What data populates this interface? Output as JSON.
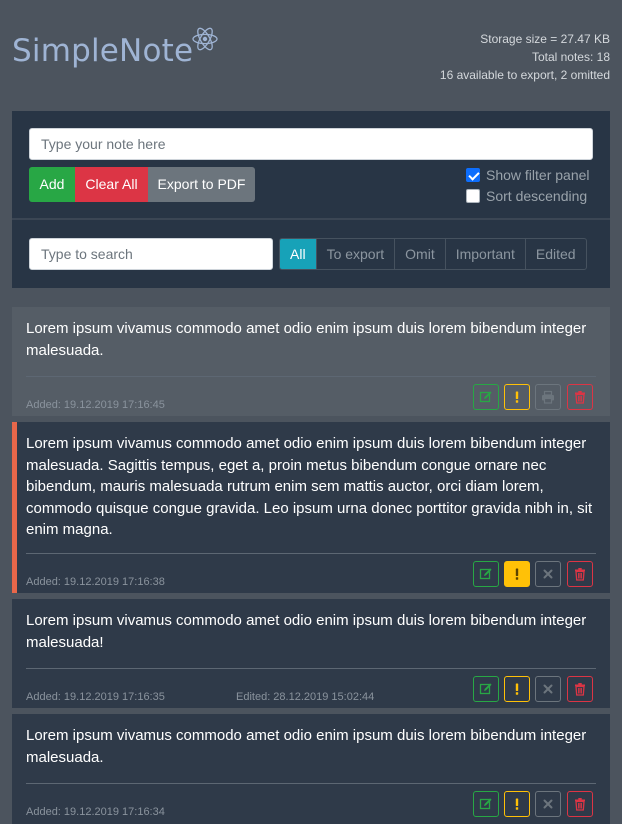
{
  "app": {
    "title": "SimpleNote",
    "logo_icon": "react-atom-icon"
  },
  "stats": {
    "storage": "Storage size = 27.47 KB",
    "total": "Total notes: 18",
    "export": "16 available to export, 2 omitted"
  },
  "form": {
    "note_placeholder": "Type your note here",
    "add_label": "Add",
    "clear_label": "Clear All",
    "export_label": "Export to PDF",
    "show_filter_label": "Show filter panel",
    "show_filter_checked": true,
    "sort_desc_label": "Sort descending",
    "sort_desc_checked": false,
    "search_placeholder": "Type to search"
  },
  "filters": [
    {
      "label": "All",
      "active": true
    },
    {
      "label": "To export",
      "active": false
    },
    {
      "label": "Omit",
      "active": false
    },
    {
      "label": "Important",
      "active": false
    },
    {
      "label": "Edited",
      "active": false
    }
  ],
  "colors": {
    "accent": "#17a2b8",
    "add": "#28a745",
    "clear": "#dc3545",
    "export": "#6c757d",
    "important": "#ffc107",
    "important_marker": "#e8674a"
  },
  "notes": [
    {
      "text": "Lorem ipsum vivamus commodo amet odio enim ipsum duis lorem bibendum integer malesuada.",
      "added": "Added: 19.12.2019 17:16:45",
      "edited": "",
      "important": false,
      "omitted": false,
      "middle_icon": "print-icon"
    },
    {
      "text": "Lorem ipsum vivamus commodo amet odio enim ipsum duis lorem bibendum integer malesuada. Sagittis tempus, eget a, proin metus bibendum congue ornare nec bibendum, mauris malesuada rutrum enim sem mattis auctor, orci diam lorem, commodo quisque congue gravida. Leo ipsum urna donec porttitor gravida nibh in, sit enim magna.",
      "added": "Added: 19.12.2019 17:16:38",
      "edited": "",
      "important": true,
      "omitted": false,
      "middle_icon": "x-icon"
    },
    {
      "text": "Lorem ipsum vivamus commodo amet odio enim ipsum duis lorem bibendum integer malesuada!",
      "added": "Added: 19.12.2019 17:16:35",
      "edited": "Edited: 28.12.2019 15:02:44",
      "important": false,
      "omitted": false,
      "middle_icon": "x-icon"
    },
    {
      "text": "Lorem ipsum vivamus commodo amet odio enim ipsum duis lorem bibendum integer malesuada.",
      "added": "Added: 19.12.2019 17:16:34",
      "edited": "",
      "important": false,
      "omitted": false,
      "middle_icon": "x-icon"
    }
  ]
}
